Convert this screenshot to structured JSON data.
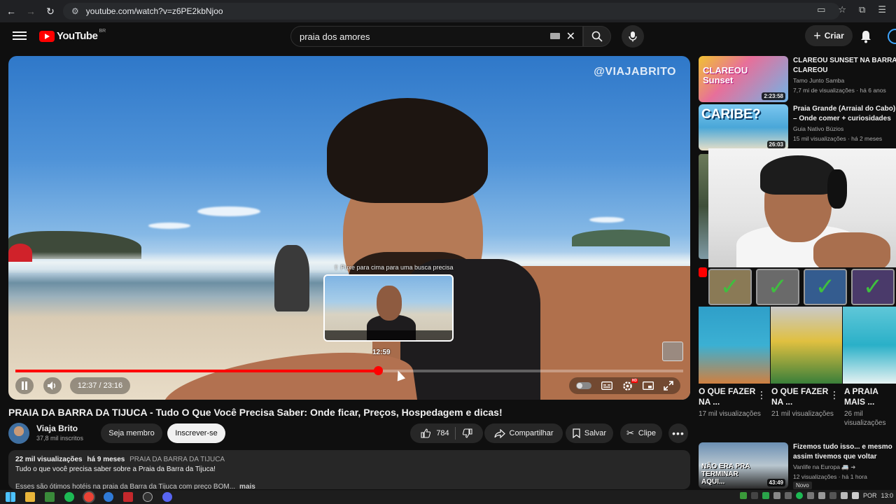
{
  "browser": {
    "url": "youtube.com/watch?v=z6PE2kbNjoo"
  },
  "header": {
    "logo_text": "YouTube",
    "country_code": "BR",
    "search_value": "praia dos amores",
    "create_label": "Criar"
  },
  "player": {
    "watermark": "@VIAJABRITO",
    "seek_hint": "⇧ Puxe para cima para uma busca precisa",
    "preview_time": "12:59",
    "time_display": "12:37 / 23:16",
    "progress_fraction": 0.543,
    "accent": "#ff0000"
  },
  "video": {
    "title": "PRAIA DA BARRA DA TIJUCA - Tudo O Que Você Precisa Saber: Onde ficar, Preços, Hospedagem e dicas!",
    "channel_name": "Viaja Brito",
    "subscribers": "37,8 mil inscritos",
    "member_label": "Seja membro",
    "subscribe_label": "Inscrever-se",
    "likes": "784",
    "share_label": "Compartilhar",
    "save_label": "Salvar",
    "clip_label": "Clipe"
  },
  "description": {
    "views": "22 mil visualizações",
    "age": "há 9 meses",
    "tag": "PRAIA DA BARRA DA TIJUCA",
    "line1": "Tudo o que você precisa saber sobre a Praia da Barra da Tijuca!",
    "line2": "Esses são ótimos hotéis na praia da Barra da Tijuca com preço BOM...",
    "more": "mais"
  },
  "recommendations": [
    {
      "title": "CLAREOU SUNSET NA BARRA CLAREOU",
      "channel": "Tamo Junto Samba",
      "meta": "7,7 mi de visualizações · há 6 anos",
      "duration": "2:23:58",
      "thumb_text": "CLAREOU Sunset"
    },
    {
      "title": "Praia Grande (Arraial do Cabo) – Onde comer + curiosidades ...",
      "channel": "Guia Nativo Búzios",
      "meta": "15 mil visualizações · há 2 meses",
      "duration": "26:03",
      "thumb_text": "CARIBE?"
    },
    {
      "title": "Fizemos tudo isso... e mesmo assim tivemos que voltar",
      "channel": "Vanlife na Europa 🚐 ➜",
      "meta": "12 visualizações · há 1 hora",
      "duration": "43:49",
      "thumb_text": "NÃO ERA PRA TERMINAR AQUI...",
      "badge": "Novo"
    }
  ],
  "shorts": [
    {
      "title": "O QUE FAZER NA ...",
      "views": "17 mil visualizações"
    },
    {
      "title": "O QUE FAZER NA ...",
      "views": "21 mil visualizações"
    },
    {
      "title": "A PRAIA MAIS ...",
      "views": "26 mil visualizações"
    }
  ],
  "taskbar": {
    "language": "POR",
    "clock": "13:0"
  }
}
